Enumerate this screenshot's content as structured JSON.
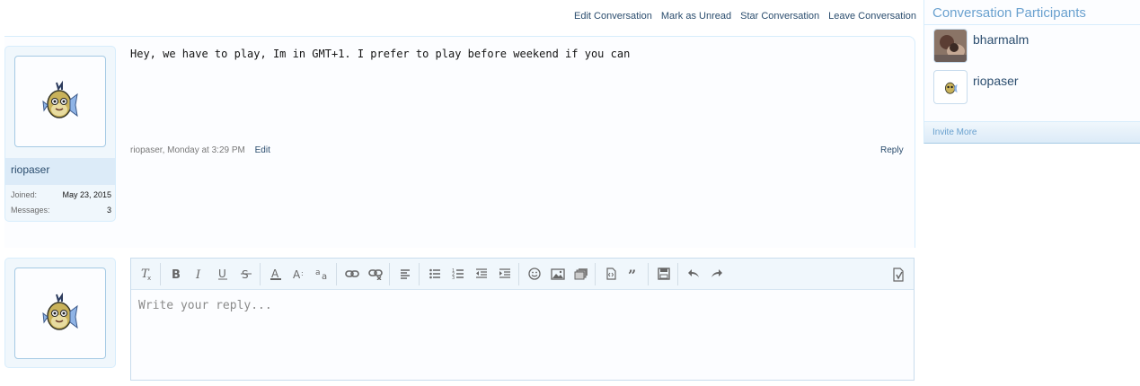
{
  "conversation_actions": {
    "edit": "Edit Conversation",
    "mark_unread": "Mark as Unread",
    "star": "Star Conversation",
    "leave": "Leave Conversation"
  },
  "message": {
    "author": "riopaser",
    "joined_label": "Joined:",
    "joined_value": "May 23, 2015",
    "messages_label": "Messages:",
    "messages_value": "3",
    "text": "Hey, we have to play, Im in GMT+1. I prefer to play before weekend if you can",
    "meta": "riopaser, Monday at 3:29 PM",
    "edit_label": "Edit",
    "reply_label": "Reply"
  },
  "reply_editor": {
    "placeholder": "Write your reply...",
    "toolbar_icons": [
      "remove-format-icon",
      "bold-icon",
      "italic-icon",
      "underline-icon",
      "strikethrough-icon",
      "font-color-icon",
      "font-size-icon",
      "font-family-icon",
      "link-icon",
      "unlink-icon",
      "align-icon",
      "bullet-list-icon",
      "numbered-list-icon",
      "outdent-icon",
      "indent-icon",
      "smilie-icon",
      "image-icon",
      "media-icon",
      "code-icon",
      "quote-icon",
      "save-draft-icon",
      "undo-icon",
      "redo-icon",
      "toggle-bbcode-icon"
    ]
  },
  "sidebar": {
    "title": "Conversation Participants",
    "participants": [
      {
        "name": "bharmalm"
      },
      {
        "name": "riopaser"
      }
    ],
    "invite_more": "Invite More"
  },
  "colors": {
    "link": "#2b4d6e",
    "accent_light": "#6aa1cf",
    "border": "#d7edfc"
  }
}
